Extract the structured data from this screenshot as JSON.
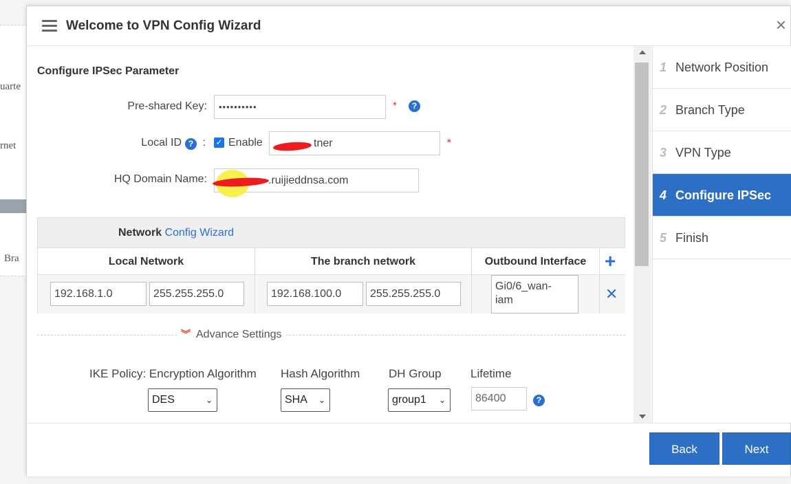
{
  "background": {
    "texts": [
      "uarte",
      "rnet",
      "Bra"
    ]
  },
  "modal": {
    "title": "Welcome to VPN Config Wizard",
    "close_glyph": "×"
  },
  "form": {
    "section_title": "Configure IPSec Parameter",
    "psk_label": "Pre-shared Key:",
    "psk_value": "••••••••••",
    "local_id_label": "Local ID",
    "local_id_colon": ":",
    "enable_label": "Enable",
    "local_id_value": "tner",
    "hq_domain_label": "HQ Domain Name:",
    "hq_domain_value": ".ruijieddnsa.com",
    "required_mark": "*",
    "help_glyph": "?"
  },
  "network": {
    "header_label": "Network",
    "header_link": "Config Wizard",
    "columns": [
      "Local Network",
      "The branch network",
      "Outbound Interface"
    ],
    "add_glyph": "+",
    "delete_glyph": "✕",
    "row": {
      "local_ip": "192.168.1.0",
      "local_mask": "255.255.255.0",
      "branch_ip": "192.168.100.0",
      "branch_mask": "255.255.255.0",
      "interface_line1": "Gi0/6_wan-",
      "interface_line2": "iam"
    }
  },
  "advance": {
    "label": "Advance Settings",
    "chevron": "⌄"
  },
  "ike": {
    "policy_label": "IKE Policy: Encryption Algorithm",
    "hash_label": "Hash Algorithm",
    "dh_label": "DH Group",
    "lifetime_label": "Lifetime",
    "encryption_value": "DES",
    "hash_value": "SHA",
    "dh_value": "group1",
    "lifetime_value": "86400"
  },
  "steps": [
    {
      "num": "1",
      "label": "Network Position"
    },
    {
      "num": "2",
      "label": "Branch Type"
    },
    {
      "num": "3",
      "label": "VPN Type"
    },
    {
      "num": "4",
      "label": "Configure IPSec"
    },
    {
      "num": "5",
      "label": "Finish"
    }
  ],
  "active_step": 4,
  "buttons": {
    "back": "Back",
    "next": "Next"
  },
  "colors": {
    "accent": "#2e6fc6",
    "required": "#e23",
    "link": "#2a6fd1"
  }
}
